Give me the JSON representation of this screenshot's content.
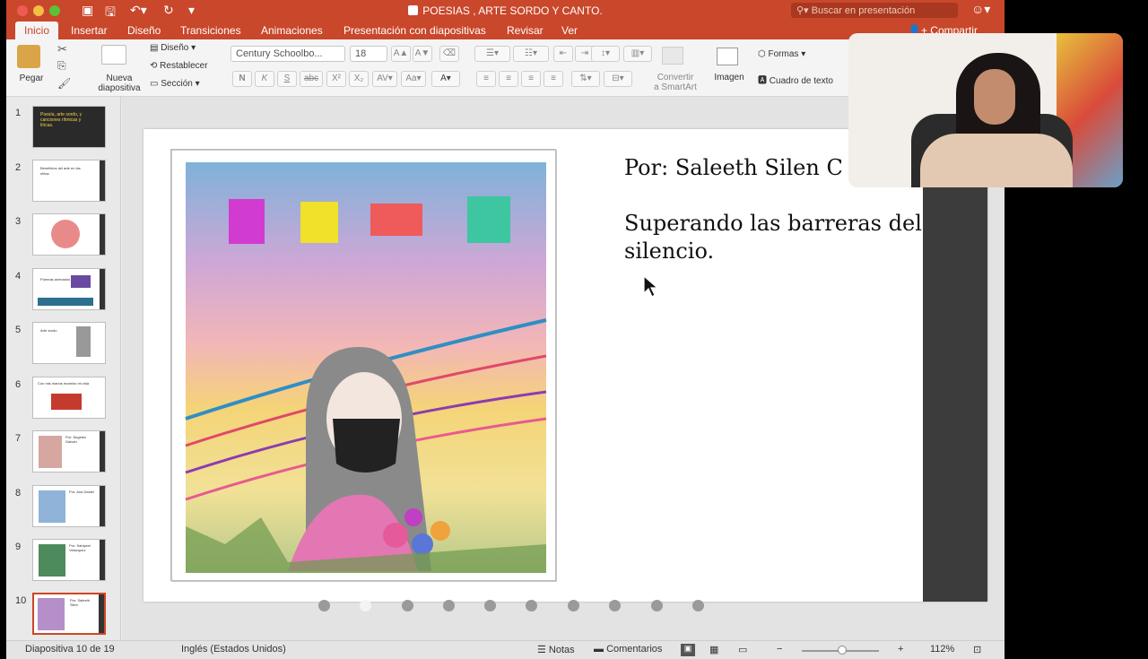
{
  "window": {
    "title": "POESIAS , ARTE SORDO Y CANTO."
  },
  "search": {
    "placeholder": "Buscar en presentación"
  },
  "ribbon_tabs": [
    "Inicio",
    "Insertar",
    "Diseño",
    "Transiciones",
    "Animaciones",
    "Presentación con diapositivas",
    "Revisar",
    "Ver"
  ],
  "share_label": "Compartir",
  "ribbon": {
    "paste": "Pegar",
    "new_slide_line1": "Nueva",
    "new_slide_line2": "diapositiva",
    "layout": "Diseño",
    "reset": "Restablecer",
    "section": "Sección",
    "font_name": "Century Schoolbo...",
    "font_size": "18",
    "convert_line1": "Convertir",
    "convert_line2": "a SmartArt",
    "image": "Imagen",
    "shapes": "Formas",
    "textbox": "Cuadro de texto"
  },
  "thumbnails": [
    {
      "num": "1",
      "text": "Poesía, arte sordo, y canciones rítmicas y líricas."
    },
    {
      "num": "2",
      "text": "Beneficios del arte en las niñas"
    },
    {
      "num": "3",
      "text": ""
    },
    {
      "num": "4",
      "text": "Poemas animados"
    },
    {
      "num": "5",
      "text": "Arte sordo"
    },
    {
      "num": "6",
      "text": "Con mis manos muestro mi vida"
    },
    {
      "num": "7",
      "text": "Por: Ángeles Galván"
    },
    {
      "num": "8",
      "text": "Por: Ana Daniel"
    },
    {
      "num": "9",
      "text": "Por: Sahiyeel Velazquez"
    },
    {
      "num": "10",
      "text": "Por: Saleeth Silen"
    }
  ],
  "slide": {
    "author": "Por: Saleeth Silen C",
    "line2": "Superando las barreras del",
    "line3": "silencio."
  },
  "status": {
    "slide_counter": "Diapositiva 10 de 19",
    "language": "Inglés (Estados Unidos)",
    "notes": "Notas",
    "comments": "Comentarios",
    "zoom": "112%"
  },
  "colors": {
    "accent": "#c9472b",
    "selected_thumb": "#d04525"
  }
}
